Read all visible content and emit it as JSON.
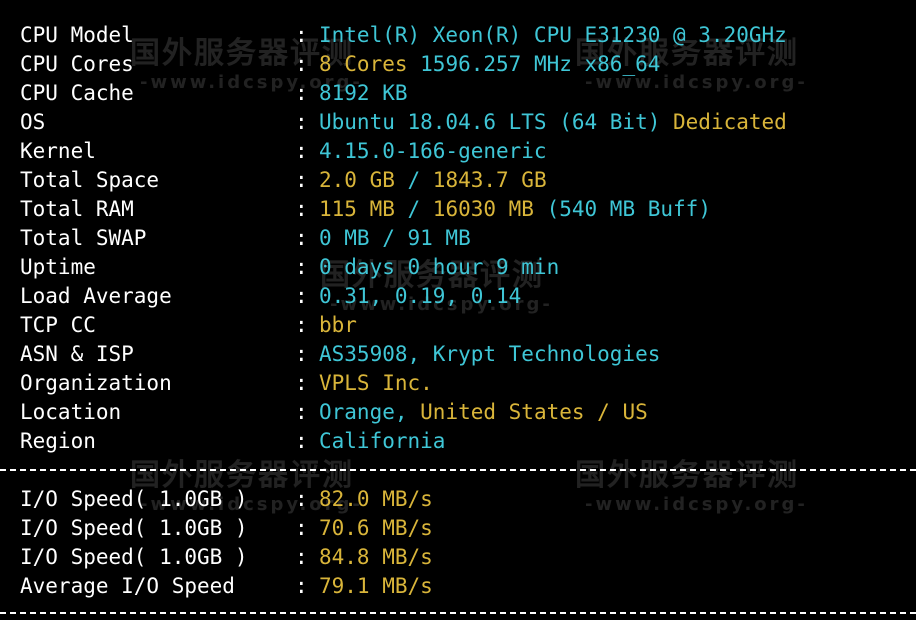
{
  "info_rows": [
    {
      "label": "CPU Model",
      "parts": [
        {
          "text": "Intel(R) Xeon(R) CPU E31230 @ 3.20GHz",
          "color": "cyan"
        }
      ]
    },
    {
      "label": "CPU Cores",
      "parts": [
        {
          "text": "8 Cores",
          "color": "yellow"
        },
        {
          "text": " 1596.257 MHz x86_64",
          "color": "cyan"
        }
      ]
    },
    {
      "label": "CPU Cache",
      "parts": [
        {
          "text": "8192 KB",
          "color": "cyan"
        }
      ]
    },
    {
      "label": "OS",
      "parts": [
        {
          "text": "Ubuntu 18.04.6 LTS (64 Bit)",
          "color": "cyan"
        },
        {
          "text": " Dedicated",
          "color": "yellow"
        }
      ]
    },
    {
      "label": "Kernel",
      "parts": [
        {
          "text": "4.15.0-166-generic",
          "color": "cyan"
        }
      ]
    },
    {
      "label": "Total Space",
      "parts": [
        {
          "text": "2.0 GB",
          "color": "yellow"
        },
        {
          "text": " / ",
          "color": "cyan"
        },
        {
          "text": "1843.7 GB",
          "color": "yellow"
        }
      ]
    },
    {
      "label": "Total RAM",
      "parts": [
        {
          "text": "115 MB",
          "color": "yellow"
        },
        {
          "text": " / ",
          "color": "cyan"
        },
        {
          "text": "16030 MB",
          "color": "yellow"
        },
        {
          "text": " (540 MB Buff)",
          "color": "cyan"
        }
      ]
    },
    {
      "label": "Total SWAP",
      "parts": [
        {
          "text": "0 MB / 91 MB",
          "color": "cyan"
        }
      ]
    },
    {
      "label": "Uptime",
      "parts": [
        {
          "text": "0 days 0 hour 9 min",
          "color": "cyan"
        }
      ]
    },
    {
      "label": "Load Average",
      "parts": [
        {
          "text": "0.31, 0.19, 0.14",
          "color": "cyan"
        }
      ]
    },
    {
      "label": "TCP CC",
      "parts": [
        {
          "text": "bbr",
          "color": "yellow"
        }
      ]
    },
    {
      "label": "ASN & ISP",
      "parts": [
        {
          "text": "AS35908, Krypt Technologies",
          "color": "cyan"
        }
      ]
    },
    {
      "label": "Organization",
      "parts": [
        {
          "text": "VPLS Inc.",
          "color": "yellow"
        }
      ]
    },
    {
      "label": "Location",
      "parts": [
        {
          "text": "Orange,",
          "color": "cyan"
        },
        {
          "text": " United States / US",
          "color": "yellow"
        }
      ]
    },
    {
      "label": "Region",
      "parts": [
        {
          "text": "California",
          "color": "cyan"
        }
      ]
    }
  ],
  "io_rows": [
    {
      "label": "I/O Speed( 1.0GB )",
      "parts": [
        {
          "text": "82.0 MB/s",
          "color": "yellow"
        }
      ]
    },
    {
      "label": "I/O Speed( 1.0GB )",
      "parts": [
        {
          "text": "70.6 MB/s",
          "color": "yellow"
        }
      ]
    },
    {
      "label": "I/O Speed( 1.0GB )",
      "parts": [
        {
          "text": "84.8 MB/s",
          "color": "yellow"
        }
      ]
    },
    {
      "label": "Average I/O Speed",
      "parts": [
        {
          "text": "79.1 MB/s",
          "color": "yellow"
        }
      ]
    }
  ],
  "separator_char": ":",
  "watermark": {
    "cn": "国外服务器评测",
    "url": "-www.idcspy.org-"
  },
  "colors": {
    "cyan": "#3fc6d6",
    "yellow": "#d9b53a",
    "text": "#ffffff",
    "background": "#000000"
  }
}
